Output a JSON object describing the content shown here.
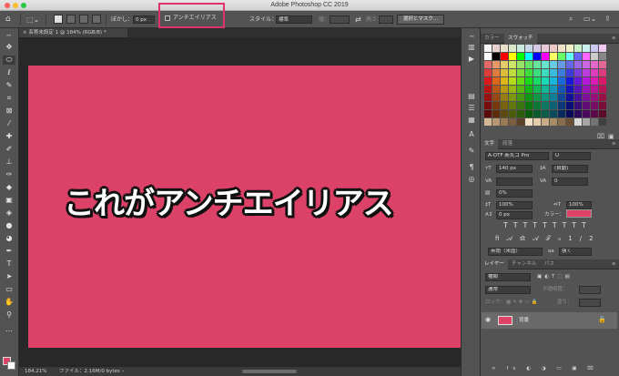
{
  "app": {
    "title": "Adobe Photoshop CC 2019"
  },
  "options": {
    "feather_label": "ぼかし：",
    "feather_value": "0 px",
    "antialias_label": "アンチエイリアス",
    "style_label": "スタイル：",
    "style_value": "標準",
    "width_label": "幅：",
    "height_label": "高さ：",
    "select_mask_label": "選択とマスク..."
  },
  "document": {
    "tab_label": "名称未設定 1 @ 184% (RGB/8) *",
    "zoom": "184.21%",
    "file_info": "ファイル：2.16M/0 bytes"
  },
  "caption": "これがアンチエイリアス",
  "color": {
    "foreground": "#dd4267",
    "background": "#ffffff"
  },
  "panels": {
    "color_tab": "カラー",
    "swatches_tab": "スウォッチ",
    "character_tab": "文字",
    "paragraph_tab": "段落",
    "font_family": "A-OTF 新丸ゴ Pro",
    "font_style": "U",
    "font_size": "140 px",
    "leading": "(自動)",
    "kerning": "0",
    "tracking_percent": "0%",
    "vscale": "100%",
    "hscale": "100%",
    "baseline": "0 px",
    "color_label": "カラー：",
    "language": "英語（米国）",
    "aa_mode_short": "aa",
    "aa_mode": "強く",
    "layers_tab": "レイヤー",
    "channels_tab": "チャンネル",
    "paths_tab": "パス",
    "layer_filter": "種類",
    "blend_mode": "通常",
    "opacity_label": "不透明度：",
    "lock_label": "ロック：",
    "fill_label": "塗り：",
    "layer_name": "背景"
  }
}
